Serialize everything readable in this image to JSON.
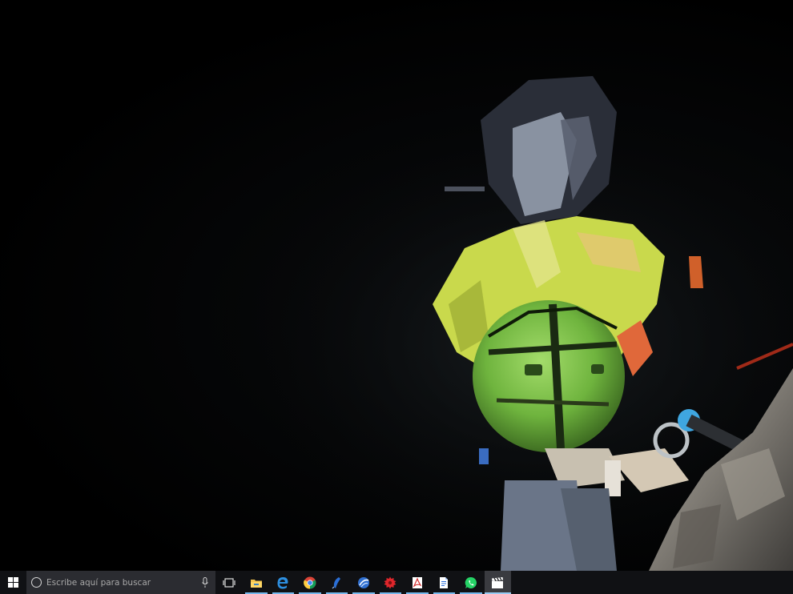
{
  "video_frame": {
    "scene": "night-climbing-helmet-cam",
    "colors": {
      "helmet": "#7cc24a",
      "jacket": "#c7d94a",
      "rock": "#8a8680",
      "carabiner": "#3fa6e0"
    }
  },
  "taskbar": {
    "start_icon": "windows-logo-icon",
    "search": {
      "placeholder": "Escribe aquí para buscar",
      "icon": "cortana-circle-icon",
      "mic_icon": "microphone-icon"
    },
    "task_view_icon": "task-view-icon",
    "pinned_apps": [
      {
        "name": "file-explorer",
        "icon": "folder-icon",
        "running": true,
        "active": false
      },
      {
        "name": "edge",
        "icon": "edge-icon",
        "running": true,
        "active": false
      },
      {
        "name": "chrome",
        "icon": "chrome-icon",
        "running": true,
        "active": false
      },
      {
        "name": "app-blue-feather",
        "icon": "feather-icon",
        "running": true,
        "active": false
      },
      {
        "name": "app-blue-globe",
        "icon": "globe-icon",
        "running": true,
        "active": false
      },
      {
        "name": "app-red-gear",
        "icon": "red-gear-icon",
        "running": true,
        "active": false
      },
      {
        "name": "pdf-reader",
        "icon": "pdf-icon",
        "running": true,
        "active": false
      },
      {
        "name": "document",
        "icon": "document-icon",
        "running": true,
        "active": false
      },
      {
        "name": "whatsapp",
        "icon": "whatsapp-icon",
        "running": true,
        "active": false
      },
      {
        "name": "video-player",
        "icon": "clapperboard-icon",
        "running": true,
        "active": true
      }
    ]
  }
}
